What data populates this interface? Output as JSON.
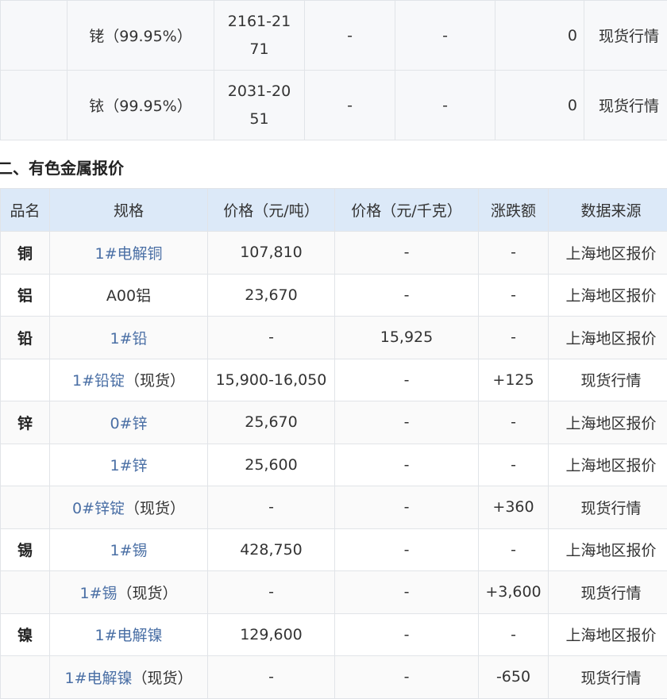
{
  "top_rows": [
    {
      "name": "铑（99.95%）",
      "price_range": "2161-2171",
      "col3": "-",
      "col4": "-",
      "change": "0",
      "source": "现货行情"
    },
    {
      "name": "铱（99.95%）",
      "price_range": "2031-2051",
      "col3": "-",
      "col4": "-",
      "change": "0",
      "source": "现货行情"
    }
  ],
  "section_title": "二、有色金属报价",
  "metal_table": {
    "headers": [
      "品名",
      "规格",
      "价格（元/吨）",
      "价格（元/千克）",
      "涨跌额",
      "数据来源"
    ],
    "rows": [
      {
        "name": "铜",
        "spec": "1#电解铜",
        "spec_link": "1#电解铜",
        "spec_suffix": "",
        "price_ton": "107,810",
        "price_kg": "-",
        "change": "-",
        "source": "上海地区报价"
      },
      {
        "name": "铝",
        "spec": "A00铝",
        "spec_link": "",
        "spec_suffix": "A00铝",
        "price_ton": "23,670",
        "price_kg": "-",
        "change": "-",
        "source": "上海地区报价"
      },
      {
        "name": "铅",
        "spec": "1#铅",
        "spec_link": "1#铅",
        "spec_suffix": "",
        "price_ton": "-",
        "price_kg": "15,925",
        "change": "-",
        "source": "上海地区报价"
      },
      {
        "name": "",
        "spec": "1#铅锭（现货）",
        "spec_link": "1#铅锭",
        "spec_suffix": "（现货）",
        "price_ton": "15,900-16,050",
        "price_kg": "-",
        "change": "+125",
        "source": "现货行情"
      },
      {
        "name": "锌",
        "spec": "0#锌",
        "spec_link": "0#锌",
        "spec_suffix": "",
        "price_ton": "25,670",
        "price_kg": "-",
        "change": "-",
        "source": "上海地区报价"
      },
      {
        "name": "",
        "spec": "1#锌",
        "spec_link": "1#锌",
        "spec_suffix": "",
        "price_ton": "25,600",
        "price_kg": "-",
        "change": "-",
        "source": "上海地区报价"
      },
      {
        "name": "",
        "spec": "0#锌锭（现货）",
        "spec_link": "0#锌锭",
        "spec_suffix": "（现货）",
        "price_ton": "-",
        "price_kg": "-",
        "change": "+360",
        "source": "现货行情"
      },
      {
        "name": "锡",
        "spec": "1#锡",
        "spec_link": "1#锡",
        "spec_suffix": "",
        "price_ton": "428,750",
        "price_kg": "-",
        "change": "-",
        "source": "上海地区报价"
      },
      {
        "name": "",
        "spec": "1#锡（现货）",
        "spec_link": "1#锡",
        "spec_suffix": "（现货）",
        "price_ton": "-",
        "price_kg": "-",
        "change": "+3,600",
        "source": "现货行情"
      },
      {
        "name": "镍",
        "spec": "1#电解镍",
        "spec_link": "1#电解镍",
        "spec_suffix": "",
        "price_ton": "129,600",
        "price_kg": "-",
        "change": "-",
        "source": "上海地区报价"
      },
      {
        "name": "",
        "spec": "1#电解镍（现货）",
        "spec_link": "1#电解镍",
        "spec_suffix": "（现货）",
        "price_ton": "-",
        "price_kg": "-",
        "change": "-650",
        "source": "现货行情"
      }
    ]
  }
}
